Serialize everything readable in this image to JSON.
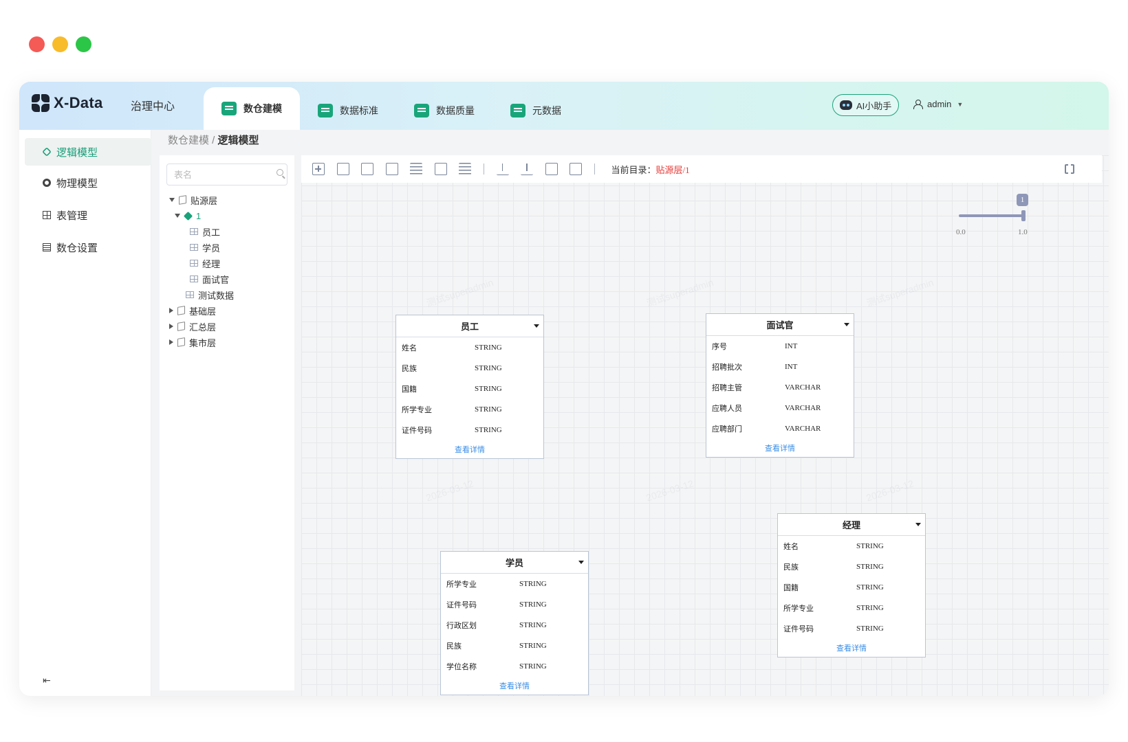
{
  "brand": {
    "name": "X-Data"
  },
  "top_nav": {
    "plain_item": "治理中心",
    "tabs": [
      {
        "label": "数仓建模",
        "active": true,
        "icon": "warehouse-icon"
      },
      {
        "label": "数据标准",
        "active": false,
        "icon": "chart-icon"
      },
      {
        "label": "数据质量",
        "active": false,
        "icon": "quality-icon"
      },
      {
        "label": "元数据",
        "active": false,
        "icon": "metadata-icon"
      }
    ],
    "ai_assistant": "AI小助手",
    "user": "admin"
  },
  "sidebar": {
    "items": [
      {
        "label": "逻辑模型",
        "active": true,
        "icon": "cube-icon"
      },
      {
        "label": "物理模型",
        "active": false,
        "icon": "circle-icon"
      },
      {
        "label": "表管理",
        "active": false,
        "icon": "table-icon"
      },
      {
        "label": "数仓设置",
        "active": false,
        "icon": "settings-doc-icon"
      }
    ]
  },
  "breadcrumb": {
    "parent": "数仓建模",
    "separator": " / ",
    "current": "逻辑模型"
  },
  "tree": {
    "search_placeholder": "表名",
    "nodes": [
      {
        "label": "贴源层",
        "expanded": true
      },
      {
        "label": "1",
        "expanded": true
      },
      {
        "label": "员工"
      },
      {
        "label": "学员"
      },
      {
        "label": "经理"
      },
      {
        "label": "面试官"
      },
      {
        "label": "测试数据"
      },
      {
        "label": "基础层",
        "expanded": false
      },
      {
        "label": "汇总层",
        "expanded": false
      },
      {
        "label": "集市层",
        "expanded": false
      }
    ]
  },
  "toolbar": {
    "current_dir_label": "当前目录：",
    "current_dir_value": "贴源层/1"
  },
  "zoom_slider": {
    "badge": "1",
    "min_label": "0.0",
    "max_label": "1.0",
    "value": 1.0
  },
  "entities": [
    {
      "title": "员工",
      "fields": [
        [
          "姓名",
          "STRING"
        ],
        [
          "民族",
          "STRING"
        ],
        [
          "国籍",
          "STRING"
        ],
        [
          "所学专业",
          "STRING"
        ],
        [
          "证件号码",
          "STRING"
        ]
      ],
      "link": "查看详情"
    },
    {
      "title": "面试官",
      "fields": [
        [
          "序号",
          "INT"
        ],
        [
          "招聘批次",
          "INT"
        ],
        [
          "招聘主管",
          "VARCHAR"
        ],
        [
          "应聘人员",
          "VARCHAR"
        ],
        [
          "应聘部门",
          "VARCHAR"
        ]
      ],
      "link": "查看详情"
    },
    {
      "title": "学员",
      "fields": [
        [
          "所学专业",
          "STRING"
        ],
        [
          "证件号码",
          "STRING"
        ],
        [
          "行政区划",
          "STRING"
        ],
        [
          "民族",
          "STRING"
        ],
        [
          "学位名称",
          "STRING"
        ]
      ],
      "link": "查看详情"
    },
    {
      "title": "经理",
      "fields": [
        [
          "姓名",
          "STRING"
        ],
        [
          "民族",
          "STRING"
        ],
        [
          "国籍",
          "STRING"
        ],
        [
          "所学专业",
          "STRING"
        ],
        [
          "证件号码",
          "STRING"
        ]
      ],
      "link": "查看详情"
    }
  ],
  "watermark": {
    "line1": "测试superadmin",
    "line2": "2026-03-12"
  },
  "colors": {
    "accent": "#1aa37a",
    "link": "#3a8ee6",
    "dir_value": "#e53935"
  }
}
